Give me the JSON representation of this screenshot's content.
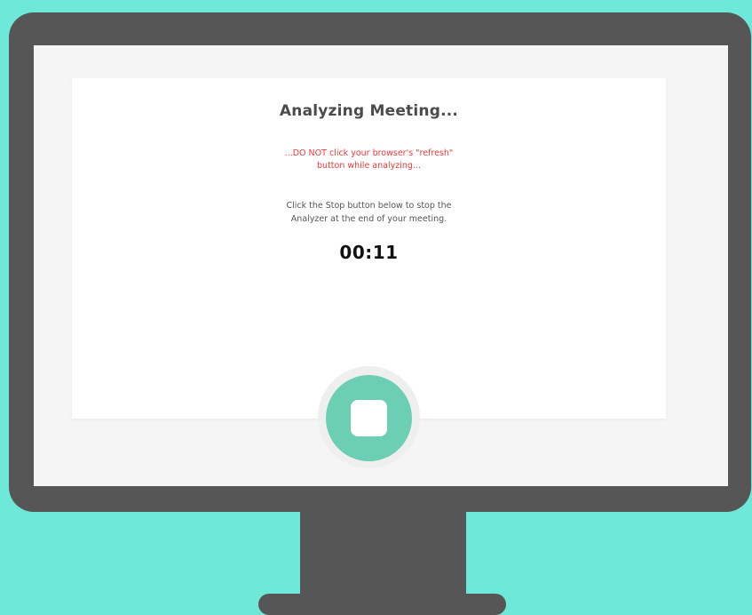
{
  "analyzer": {
    "title": "Analyzing Meeting...",
    "warning_line1": "...DO NOT click your browser's \"refresh\"",
    "warning_line2": "button while analyzing...",
    "instruction_line1": "Click the Stop button below to stop the",
    "instruction_line2": "Analyzer at the end of your meeting.",
    "timer": "00:11"
  },
  "stop_button": {
    "icon": "stop-icon"
  },
  "colors": {
    "background": "#6de8d9",
    "monitor": "#565656",
    "screen": "#f5f5f5",
    "warning": "#ee3a3a",
    "accent": "#6ccfb3"
  }
}
